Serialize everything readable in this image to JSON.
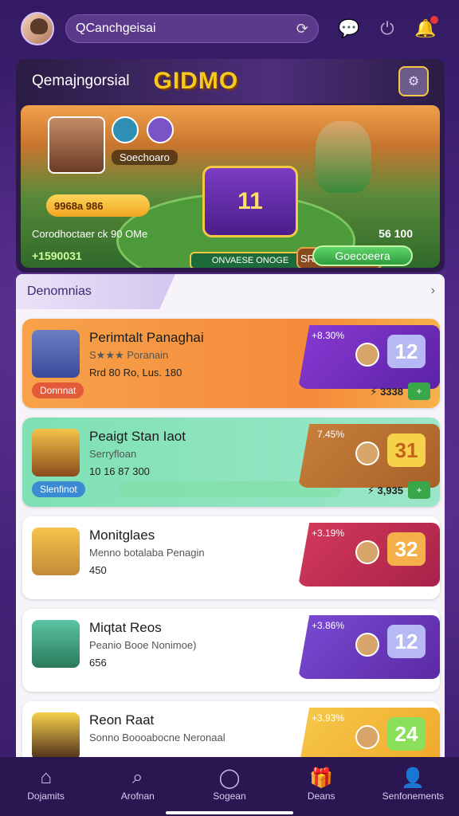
{
  "topbar": {
    "search_value": "QCanchgeisai",
    "icons": [
      "avatar",
      "refresh-icon",
      "chat-icon",
      "power-icon",
      "bell-icon"
    ]
  },
  "hero": {
    "title": "Qemajngorsial",
    "logo_text": "GIDMO",
    "profile_sub": "Soechoaro",
    "gold_pill": "9968a 986",
    "center_number": "11",
    "center_label": "ONVAESE ONOGE",
    "right_label": "SROCIAN JEGO",
    "row1_left": "Corodhoctaer ck 90 OMe",
    "row1_right": "56 100",
    "row2_left": "+1590031",
    "button_label": "Goecoeera"
  },
  "panel": {
    "tab_label": "Denomnias",
    "arrow": "›",
    "items": [
      {
        "title": "Perimtalt Panaghai",
        "sub": "S★★★ Poranain",
        "stats": "Rrd 80 Ro, Lus. 180",
        "pct": "+8.30%",
        "number": "12",
        "tag": "Donnnat",
        "coins": "⚡ 3338",
        "gbtn": "+"
      },
      {
        "title": "Peaigt Stan Iaot",
        "sub": "Serryfloan",
        "stats": "10 16 87 300",
        "pct": "7.45%",
        "number": "31",
        "tag": "Slenfinot",
        "coins": "⚡ 3,935",
        "gbtn": "+"
      },
      {
        "title": "Monitglaes",
        "sub": "Menno botalaba Penagin",
        "stats": "450",
        "pct": "+3.19%",
        "number": "32"
      },
      {
        "title": "Miqtat Reos",
        "sub": "Peanio Booe Nonimoe)",
        "stats": "656",
        "pct": "+3.86%",
        "number": "12"
      },
      {
        "title": "Reon Raat",
        "sub": "Sonno Boooabocne Neronaal",
        "stats": "",
        "pct": "+3.93%",
        "number": "24"
      }
    ]
  },
  "bottomnav": {
    "items": [
      {
        "label": "Dojamits",
        "icon": "home-icon"
      },
      {
        "label": "Arofnan",
        "icon": "search-icon"
      },
      {
        "label": "Sogean",
        "icon": "circle-icon"
      },
      {
        "label": "Deans",
        "icon": "gift-icon"
      },
      {
        "label": "Senfonements",
        "icon": "profile-icon"
      }
    ]
  },
  "colors": {
    "accent": "#7b3cc4",
    "card1": "#f48a3a",
    "card2": "#5fd3a4",
    "card3": "#c23a5a",
    "card4": "#6a3cc4",
    "card5": "#f4b83a"
  }
}
